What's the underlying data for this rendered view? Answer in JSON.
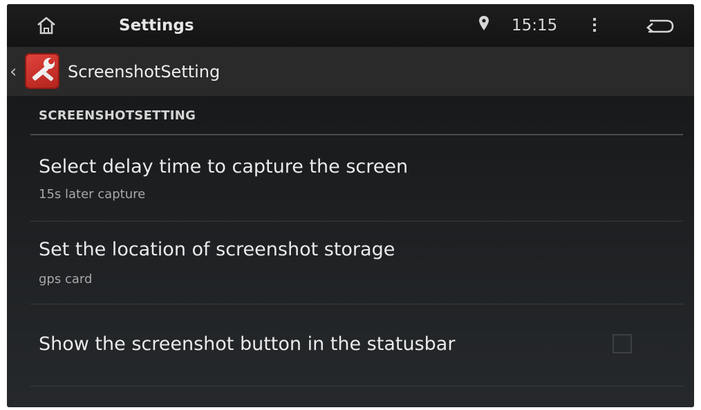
{
  "statusbar": {
    "title": "Settings",
    "time": "15:15",
    "icons": [
      "home-icon",
      "location-pin-icon",
      "overflow-menu-icon",
      "back-icon"
    ]
  },
  "actionbar": {
    "title": "ScreenshotSetting",
    "icons": [
      "up-chevron-icon",
      "screenshot-settings-app-icon"
    ]
  },
  "section": {
    "header": "SCREENSHOTSETTING"
  },
  "preferences": [
    {
      "title": "Select delay time to capture the screen",
      "summary": "15s later capture"
    },
    {
      "title": "Set the location of screenshot storage",
      "summary": "gps card"
    },
    {
      "title": "Show the screenshot button in the statusbar",
      "checked": false
    }
  ],
  "colors": {
    "background": "#1c1e20",
    "actionbar": "#2a2a2a",
    "app_icon": "#c9302a"
  }
}
